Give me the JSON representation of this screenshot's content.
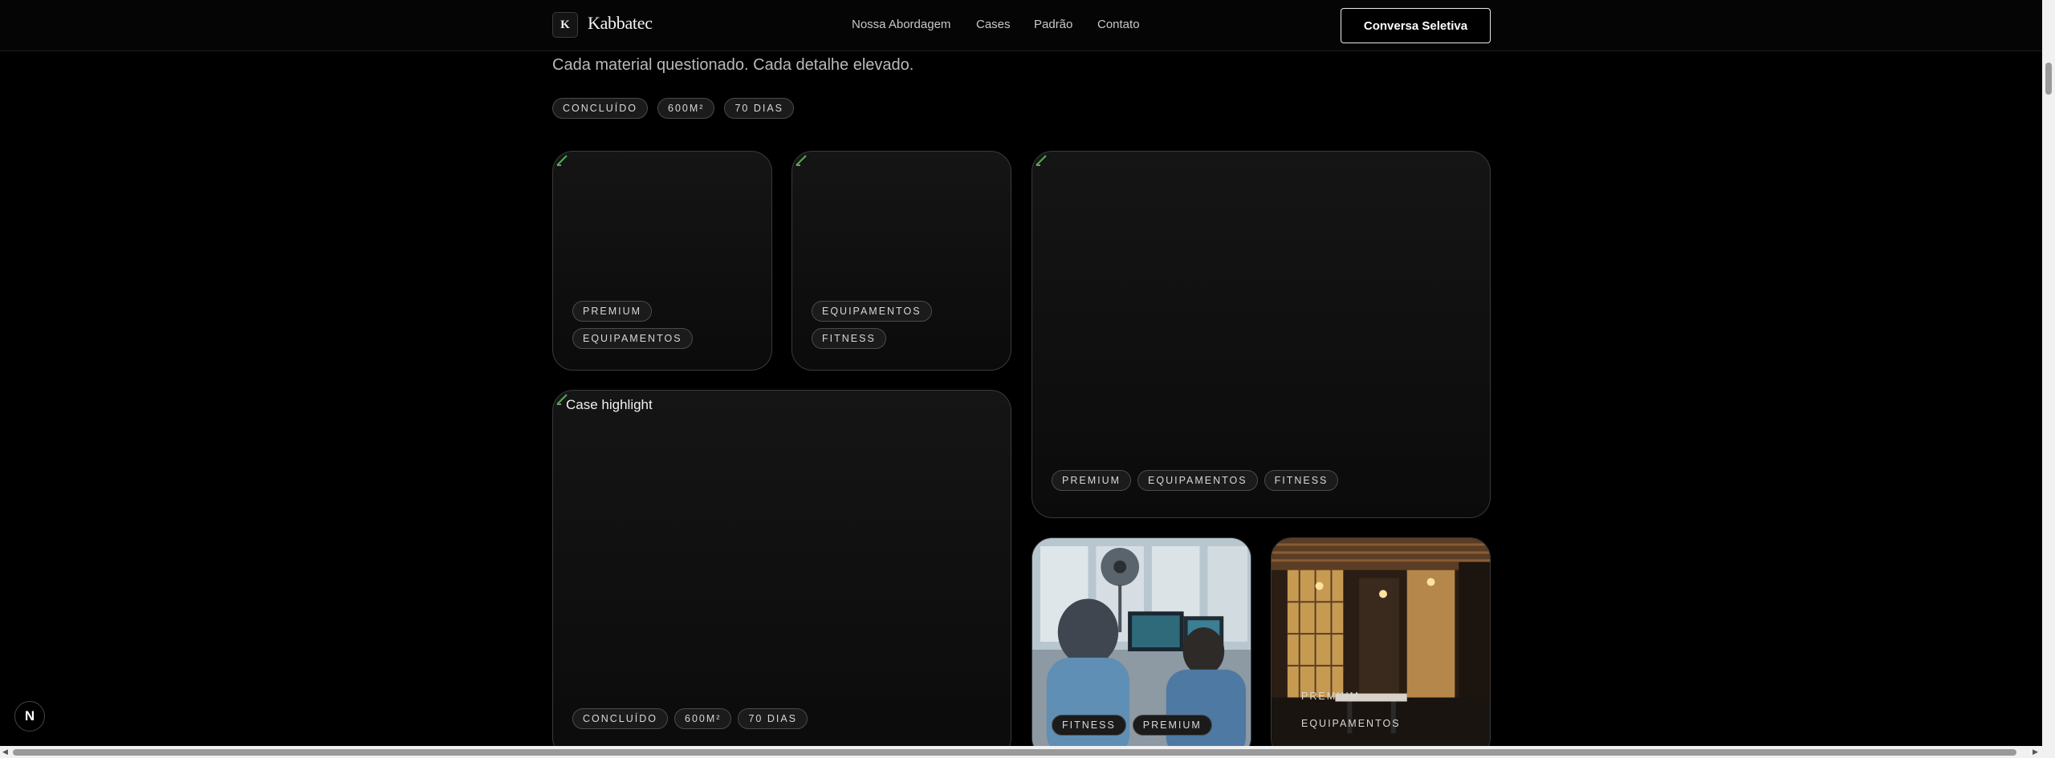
{
  "nav": {
    "logo_letter": "K",
    "brand": "Kabbatec",
    "links": [
      "Nossa Abordagem",
      "Cases",
      "Padrão",
      "Contato"
    ],
    "cta": "Conversa Seletiva"
  },
  "hero": {
    "intro_line": "Cada material questionado. Cada detalhe elevado.",
    "meta_tags": [
      "CONCLUÍDO",
      "600M²",
      "70 DIAS"
    ]
  },
  "cards": [
    {
      "tags": [
        "PREMIUM",
        "EQUIPAMENTOS"
      ]
    },
    {
      "tags": [
        "EQUIPAMENTOS",
        "FITNESS"
      ]
    },
    {
      "tags": [
        "PREMIUM",
        "EQUIPAMENTOS",
        "FITNESS"
      ]
    },
    {
      "alt": "Case highlight",
      "tags": [
        "CONCLUÍDO",
        "600M²",
        "70 DIAS"
      ]
    },
    {
      "tags": [
        "FITNESS",
        "PREMIUM"
      ]
    },
    {
      "tags": [
        "PREMIUM",
        "EQUIPAMENTOS"
      ]
    }
  ],
  "floating_badge": "N",
  "colors": {
    "background": "#000000",
    "card": "#121212",
    "tag_bg": "#1b1b1b",
    "accent": "#ffffff"
  }
}
